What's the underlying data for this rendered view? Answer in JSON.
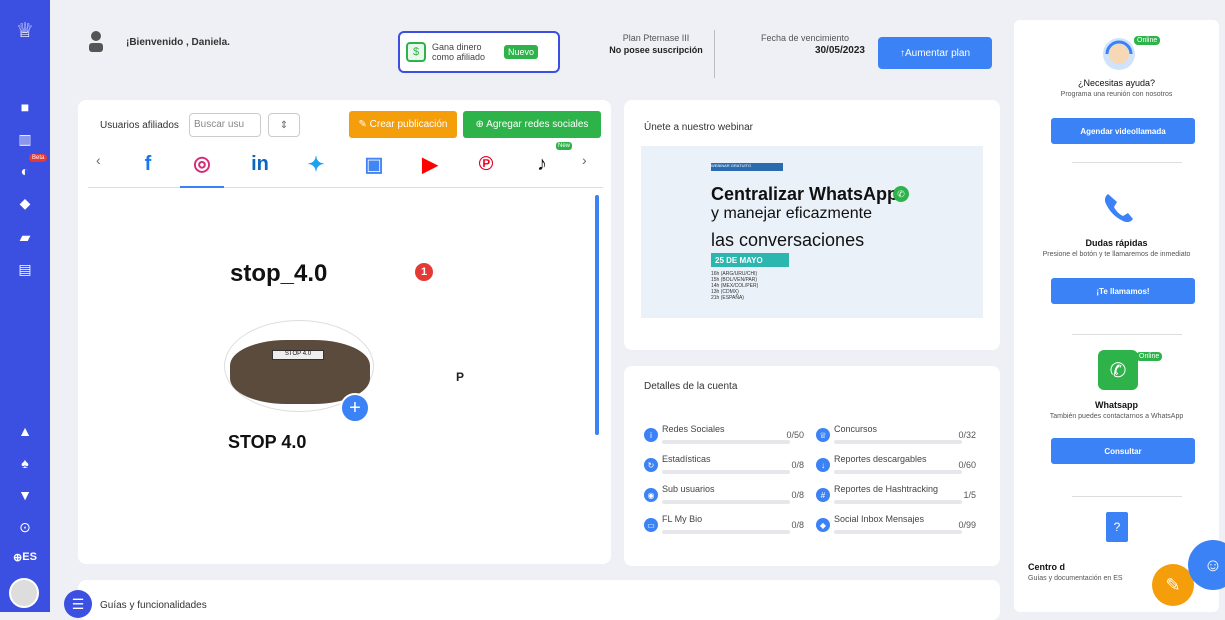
{
  "colors": {
    "primary": "#3b4fe0",
    "accent_blue": "#3b82f6",
    "orange": "#f59e0b",
    "green": "#2db34a",
    "red": "#e53935"
  },
  "sidebar": {
    "logo_icon": "trophy-icon",
    "items": [
      {
        "icon": "briefcase-icon"
      },
      {
        "icon": "chart-icon"
      },
      {
        "icon": "rocket-icon",
        "badge": "Beta"
      },
      {
        "icon": "chat-icon"
      },
      {
        "icon": "users-icon"
      },
      {
        "icon": "document-icon"
      },
      {
        "icon": "warning-icon"
      },
      {
        "icon": "bell-icon"
      },
      {
        "icon": "cart-icon"
      },
      {
        "icon": "help-icon"
      }
    ],
    "language": "ES"
  },
  "header": {
    "welcome": "¡Bienvenido , Daniela.",
    "earn_text": "Gana dinero como afiliado",
    "earn_badge": "Nuevo",
    "plan_label": "Plan Pternase III",
    "plan_value": "No posee suscripción",
    "expiry_label": "Fecha de vencimiento",
    "expiry_value": "30/05/2023",
    "upgrade_button": "↑Aumentar plan"
  },
  "main": {
    "affiliates_label": "Usuarios afiliados",
    "search_placeholder": "Buscar usu",
    "sort_symbol": "⇕",
    "create_button": "✎ Crear publicación",
    "add_networks_button": "⊕ Agregar redes sociales",
    "tiktok_badge": "New",
    "profile_name": "stop_4.0",
    "profile_badge": "1",
    "pic_label": "STOP 4.0",
    "p_letter": "P",
    "account_name": "STOP 4.0"
  },
  "webinar": {
    "title": "Únete a nuestro webinar",
    "tag": "WEBINAR GRATUITO",
    "headline1": "Centralizar WhatsApp",
    "headline2": "y manejar eficazmente",
    "headline3": "las conversaciones",
    "date": "25 DE MAYO",
    "lines": [
      "16h (ARG/URU/CHI)",
      "15h (BOL/VEN/PAR)",
      "14h (MEX/COL/PER)",
      "13h (CDMX)",
      "21h (ESPAÑA)"
    ]
  },
  "details": {
    "title": "Detalles de la cuenta",
    "items": [
      {
        "label": "Redes Sociales",
        "value": "0/50",
        "icon": "info-icon"
      },
      {
        "label": "Concursos",
        "value": "0/32",
        "icon": "trophy-icon"
      },
      {
        "label": "Estadísticas",
        "value": "0/8",
        "icon": "refresh-icon"
      },
      {
        "label": "Reportes descargables",
        "value": "0/60",
        "icon": "download-icon"
      },
      {
        "label": "Sub usuarios",
        "value": "0/8",
        "icon": "users-icon"
      },
      {
        "label": "Reportes de Hashtracking",
        "value": "1/5",
        "icon": "hashtag-icon"
      },
      {
        "label": "FL My Bio",
        "value": "0/8",
        "icon": "id-icon"
      },
      {
        "label": "Social Inbox Mensajes",
        "value": "0/99",
        "icon": "chat-icon"
      }
    ]
  },
  "guides": {
    "label": "Guías y funcionalidades"
  },
  "right_panel": {
    "online_badge": "Online",
    "help_title": "¿Necesitas ayuda?",
    "help_desc": "Programa una reunión con nosotros",
    "help_button": "Agendar videollamada",
    "quick_title": "Dudas rápidas",
    "quick_desc": "Presione el botón y te llamaremos de inmediato",
    "quick_button": "¡Te llamamos!",
    "wa_title": "Whatsapp",
    "wa_desc": "También puedes contactarnos a WhatsApp",
    "wa_button": "Consultar",
    "center_title": "Centro d",
    "center_desc": "Guías y documentación en ES"
  }
}
